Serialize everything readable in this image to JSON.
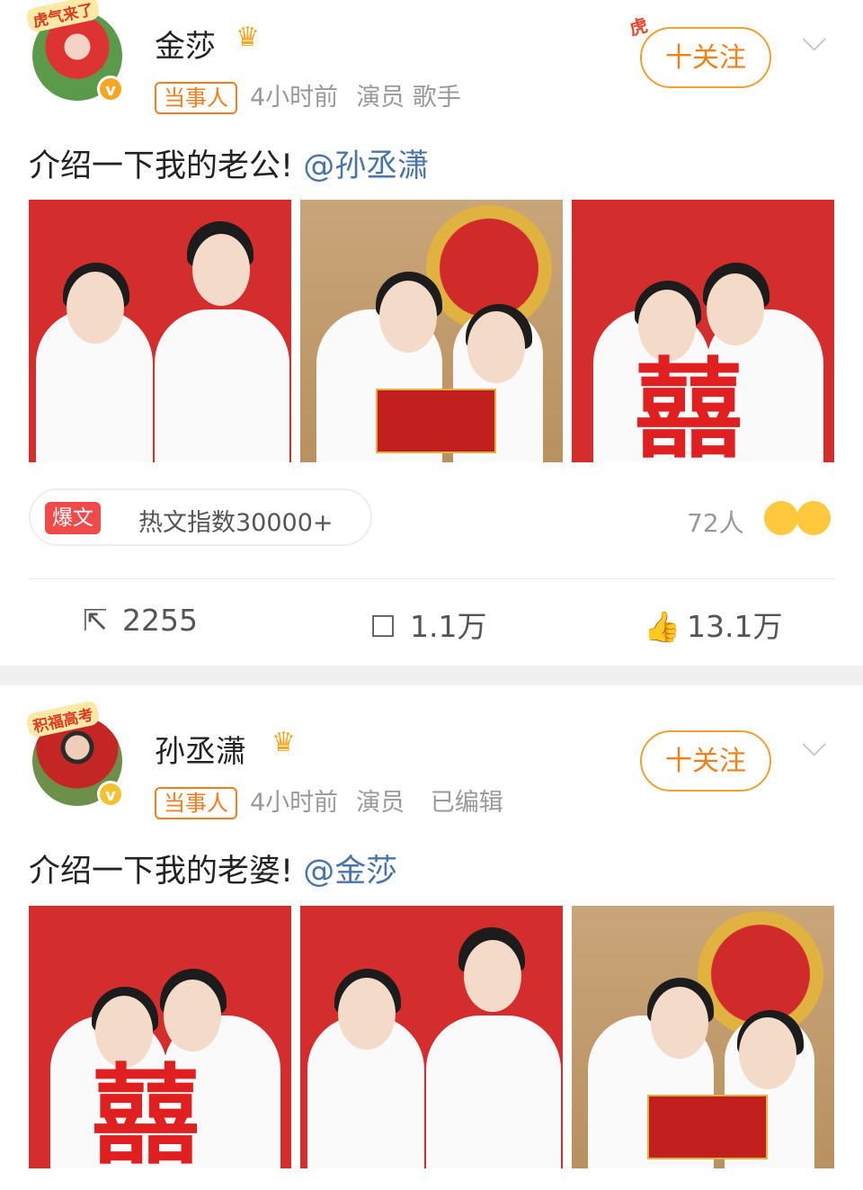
{
  "posts": [
    {
      "author": "金莎",
      "tag": "当事人",
      "time": "4小时前",
      "labels": [
        "演员",
        "歌手"
      ],
      "follow_label": "十关注",
      "avatar_frame_text": "虎气来了",
      "content_prefix": "介绍一下我的老公!",
      "mention": "@孙丞潇",
      "hot_badge": "爆文",
      "hot_index": "热文指数30000+",
      "reactions_count": "72人",
      "actions": {
        "repost": "2255",
        "comment": "1.1万",
        "like": "13.1万"
      }
    },
    {
      "author": "孙丞潇",
      "tag": "当事人",
      "time": "4小时前",
      "labels": [
        "演员",
        "已编辑"
      ],
      "follow_label": "十关注",
      "avatar_frame_text": "积福高考",
      "content_prefix": "介绍一下我的老婆!",
      "mention": "@金莎"
    }
  ],
  "icons": {
    "verified": "v-badge-icon",
    "crown": "crown-icon",
    "chevron": "chevron-down-icon",
    "repost": "repost-icon",
    "comment": "comment-icon",
    "like": "like-icon"
  },
  "colors": {
    "accent": "#f08018",
    "mention": "#4a74a8",
    "hot": "#f04a4a"
  }
}
